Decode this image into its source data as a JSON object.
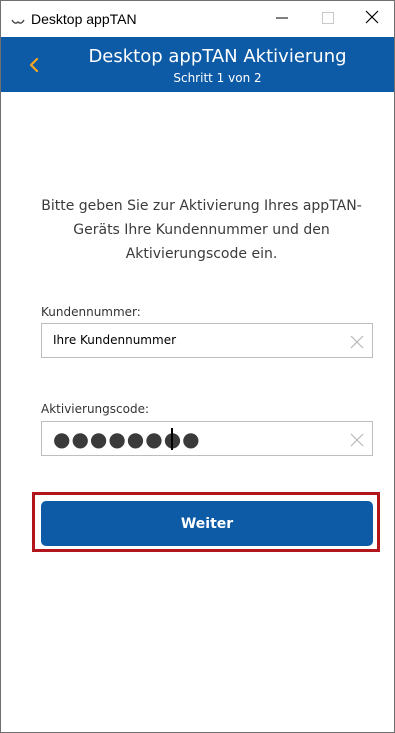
{
  "window": {
    "title": "Desktop appTAN",
    "icon": "app-logo-icon",
    "controls": [
      "minimize-icon",
      "maximize-icon",
      "close-icon"
    ]
  },
  "header": {
    "title": "Desktop appTAN Aktivierung",
    "subtitle": "Schritt 1 von 2",
    "back_icon": "chevron-left-icon",
    "background_color": "#0d5ba6",
    "text_color": "#ffffff"
  },
  "intro": {
    "text": "Bitte geben Sie zur Aktivierung Ihres appTAN-Geräts Ihre Kundennummer und den Aktivierungscode ein."
  },
  "form": {
    "customer_number": {
      "label": "Kundennummer:",
      "value": "Ihre Kundennummer",
      "clear_icon": "clear-x-icon"
    },
    "activation_code": {
      "label": "Aktivierungscode:",
      "masked_value": "●●●●●●●●",
      "clear_icon": "clear-x-icon"
    }
  },
  "actions": {
    "next_label": "Weiter",
    "button_color": "#0d5ba6",
    "highlight_color": "#b3151d"
  }
}
